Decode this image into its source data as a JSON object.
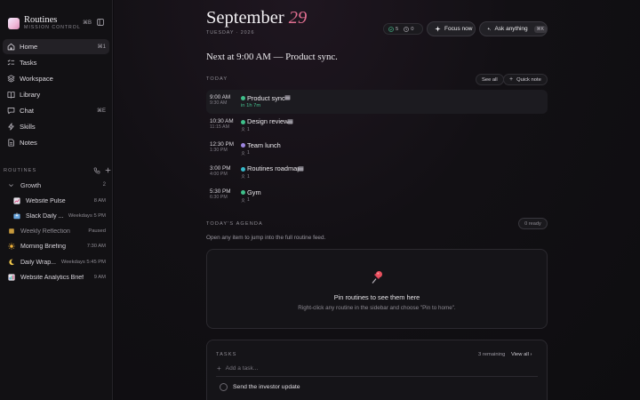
{
  "app": {
    "name": "Routines",
    "subtitle": "MISSION CONTROL",
    "shortcut": "⌘B"
  },
  "nav": [
    {
      "label": "Home",
      "shortcut": "⌘1",
      "active": true
    },
    {
      "label": "Tasks"
    },
    {
      "label": "Workspace"
    },
    {
      "label": "Library"
    },
    {
      "label": "Chat",
      "shortcut": "⌘E"
    },
    {
      "label": "Skills"
    },
    {
      "label": "Notes"
    }
  ],
  "routines_section": {
    "label": "ROUTINES",
    "group": {
      "name": "Growth",
      "count": "2"
    },
    "items": [
      {
        "label": "Website Pulse",
        "meta": "8 AM"
      },
      {
        "label": "Slack Daily ...",
        "meta": "Weekdays 5 PM"
      },
      {
        "label": "Weekly Reflection",
        "meta": "Paused"
      },
      {
        "label": "Morning Briefing",
        "meta": "7:30 AM"
      },
      {
        "label": "Daily Wrap...",
        "meta": "Weekdays 5:45 PM"
      },
      {
        "label": "Website Analytics Brief",
        "meta": "9 AM"
      }
    ]
  },
  "header": {
    "month": "September",
    "day": "29",
    "subline": "TUESDAY · 2026",
    "counter_done": "5",
    "counter_pending": "0",
    "focus_label": "Focus now",
    "ask_label": "Ask anything",
    "ask_kbd": "⌘K"
  },
  "next_up": "Next at 9:00 AM — Product sync.",
  "today": {
    "label": "TODAY",
    "see_all": "See all",
    "quick_note": "Quick note",
    "events": [
      {
        "start": "9:00 AM",
        "end": "9:30 AM",
        "title": "Product sync",
        "eta": "in 1h 7m",
        "color": "#3fbf8a"
      },
      {
        "start": "10:30 AM",
        "end": "11:15 AM",
        "title": "Design review",
        "attendees": "1",
        "color": "#3fbf8a"
      },
      {
        "start": "12:30 PM",
        "end": "1:30 PM",
        "title": "Team lunch",
        "attendees": "1",
        "color": "#9d86e0"
      },
      {
        "start": "3:00 PM",
        "end": "4:00 PM",
        "title": "Routines roadmap",
        "attendees": "1",
        "color": "#37b8c9"
      },
      {
        "start": "5:30 PM",
        "end": "6:30 PM",
        "title": "Gym",
        "attendees": "1",
        "color": "#3fbf8a"
      }
    ]
  },
  "agenda": {
    "label": "TODAY'S AGENDA",
    "ready": "0 ready",
    "subtitle": "Open any item to jump into the full routine feed.",
    "empty_title": "Pin routines to see them here",
    "empty_desc": "Right-click any routine in the sidebar and choose \"Pin to home\"."
  },
  "tasks": {
    "label": "TASKS",
    "remaining": "3 remaining",
    "view_all": "View all ›",
    "add_placeholder": "Add a task...",
    "items": [
      {
        "label": "Send the investor update"
      }
    ]
  },
  "colors": {
    "accent_day": "#e16f91",
    "eta_green": "#46c08f"
  }
}
